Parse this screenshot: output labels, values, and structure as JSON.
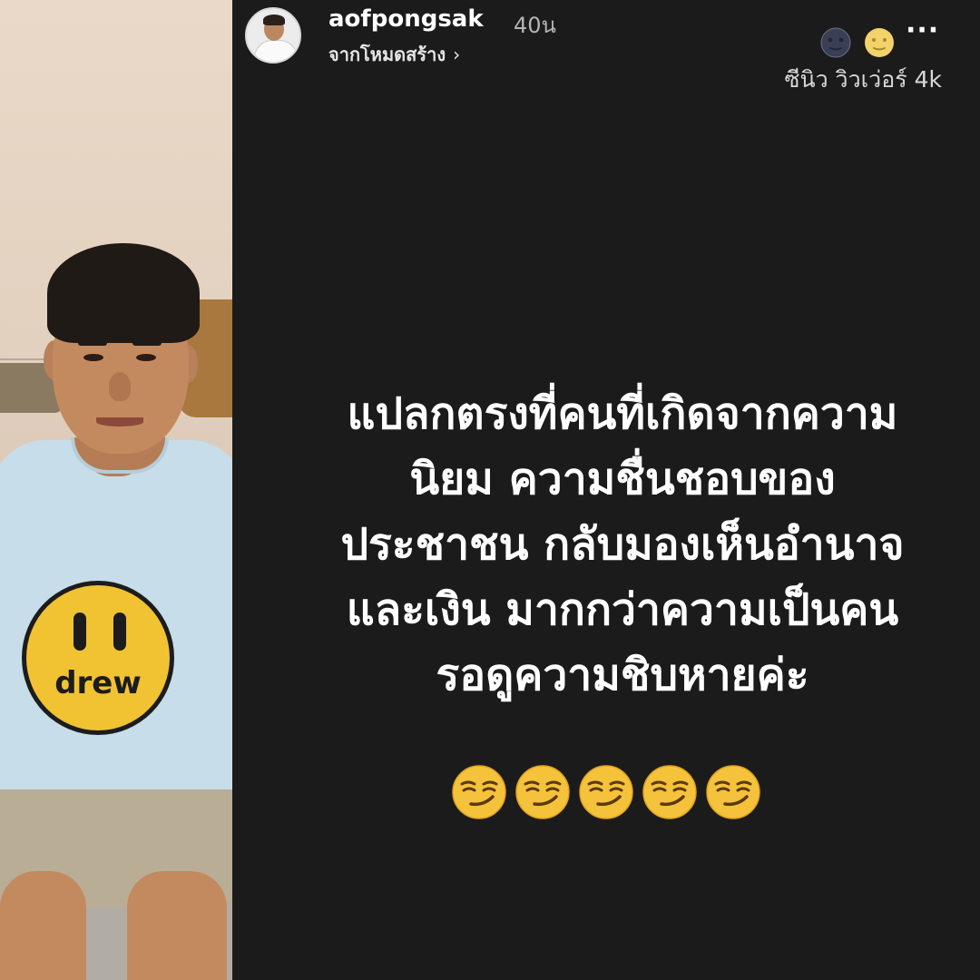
{
  "story": {
    "username": "aofpongsak",
    "time": "40น",
    "source": "จากโหมดสร้าง",
    "source_chevron": "›",
    "more": "···",
    "viewer_line": "ซีนิว วิวเว่อร์ 4k",
    "message_lines": [
      "แปลกตรงที่คนที่เกิดจากความ",
      "นิยม ความชื่นชอบของ",
      "ประชาชน กลับมองเห็นอำนาจ",
      "และเงิน มากกว่าความเป็นคน",
      "รอดูความชิบหายค่ะ"
    ],
    "emoji_count": 5,
    "emoji_name": "smirking-face"
  },
  "photo": {
    "shirt_text": "drew"
  },
  "colors": {
    "background": "#1b1b1b",
    "text": "#ffffff",
    "emoji_yellow": "#f5c33b"
  }
}
